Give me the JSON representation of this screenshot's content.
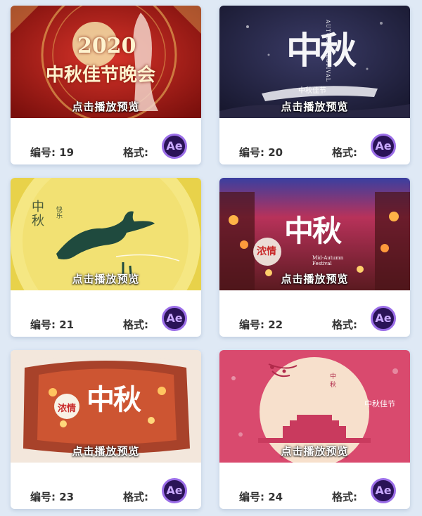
{
  "play_label": "点击播放预览",
  "number_prefix": "编号:",
  "format_prefix": "格式:",
  "format_badge": "Ae",
  "colors": {
    "page_bg": "#dfe9f5",
    "card_bg": "#ffffff",
    "badge_bg": "#2a1357",
    "badge_ring": "#9b6ee8"
  },
  "cards": [
    {
      "id": "19",
      "thumb_title_year": "2020",
      "thumb_title": "中秋佳节晚会",
      "theme": "red-ornamental"
    },
    {
      "id": "20",
      "thumb_title": "中秋",
      "thumb_subtitle": "中秋佳节",
      "thumb_side_text": "AUTUMN FESTIVAL",
      "theme": "night-ink"
    },
    {
      "id": "21",
      "thumb_title": "中秋",
      "thumb_side_text": "快乐",
      "theme": "yellow-moon-rabbit"
    },
    {
      "id": "22",
      "thumb_title": "中秋",
      "thumb_subtitle": "浓情",
      "thumb_side_text": "Mid-Autumn Festival",
      "theme": "lantern-street"
    },
    {
      "id": "23",
      "thumb_title": "中秋",
      "thumb_subtitle": "浓情",
      "theme": "lantern-street-faded"
    },
    {
      "id": "24",
      "thumb_title": "中秋",
      "thumb_side_text": "中秋佳节",
      "theme": "pink-moon"
    }
  ]
}
